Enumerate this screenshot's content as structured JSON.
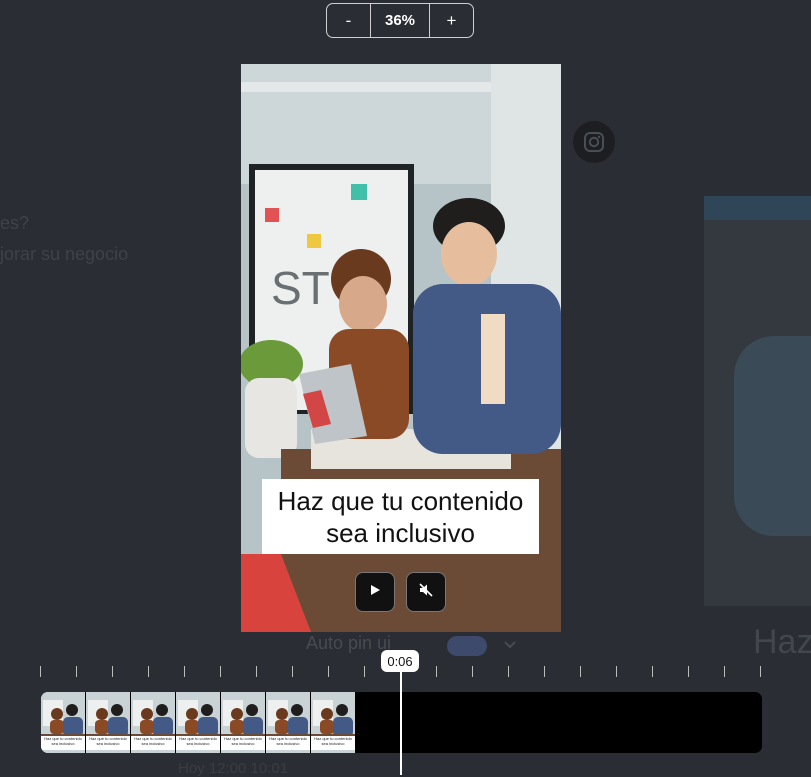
{
  "zoom": {
    "minus_label": "-",
    "value": "36%",
    "plus_label": "+"
  },
  "background": {
    "fragment_line1": "es?",
    "fragment_line2": "jorar su negocio",
    "right_title_fragment": "Haz",
    "auto_caption_label": "Auto pin ui",
    "bottom_fragment": "Hoy 12:00 10:01"
  },
  "preview": {
    "caption": "Haz que tu contenido sea inclusivo",
    "play_icon": "play-icon",
    "mute_icon": "muted-speaker-icon"
  },
  "timeline": {
    "current_time": "0:06",
    "thumb_caption": "Haz que tu contenido sea inclusivo",
    "thumb_count": 7
  },
  "colors": {
    "background": "#2a2d33",
    "track": "#000000",
    "accent_toggle": "#3d4a6b"
  }
}
